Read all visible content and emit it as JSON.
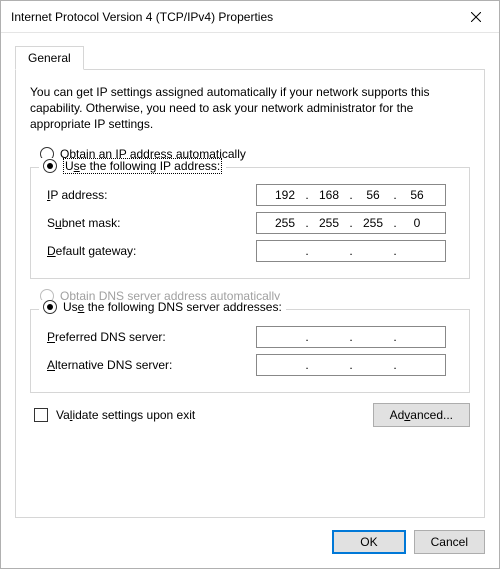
{
  "window": {
    "title": "Internet Protocol Version 4 (TCP/IPv4) Properties"
  },
  "tabs": {
    "general": "General"
  },
  "intro": "You can get IP settings assigned automatically if your network supports this capability. Otherwise, you need to ask your network administrator for the appropriate IP settings.",
  "ip": {
    "auto_label": "Obtain an IP address automatically",
    "manual_label": "Use the following IP address:",
    "auto_selected": false,
    "fields": {
      "address_label": "IP address:",
      "address": {
        "o1": "192",
        "o2": "168",
        "o3": "56",
        "o4": "56"
      },
      "subnet_label": "Subnet mask:",
      "subnet": {
        "o1": "255",
        "o2": "255",
        "o3": "255",
        "o4": "0"
      },
      "gateway_label": "Default gateway:",
      "gateway": {
        "o1": "",
        "o2": "",
        "o3": "",
        "o4": ""
      }
    }
  },
  "dns": {
    "auto_label": "Obtain DNS server address automatically",
    "manual_label": "Use the following DNS server addresses:",
    "auto_selected": false,
    "auto_enabled": false,
    "fields": {
      "preferred_label": "Preferred DNS server:",
      "preferred": {
        "o1": "",
        "o2": "",
        "o3": "",
        "o4": ""
      },
      "alternate_label": "Alternative DNS server:",
      "alternate": {
        "o1": "",
        "o2": "",
        "o3": "",
        "o4": ""
      }
    }
  },
  "validate_label": "Validate settings upon exit",
  "validate_checked": false,
  "buttons": {
    "advanced": "Advanced...",
    "ok": "OK",
    "cancel": "Cancel"
  }
}
